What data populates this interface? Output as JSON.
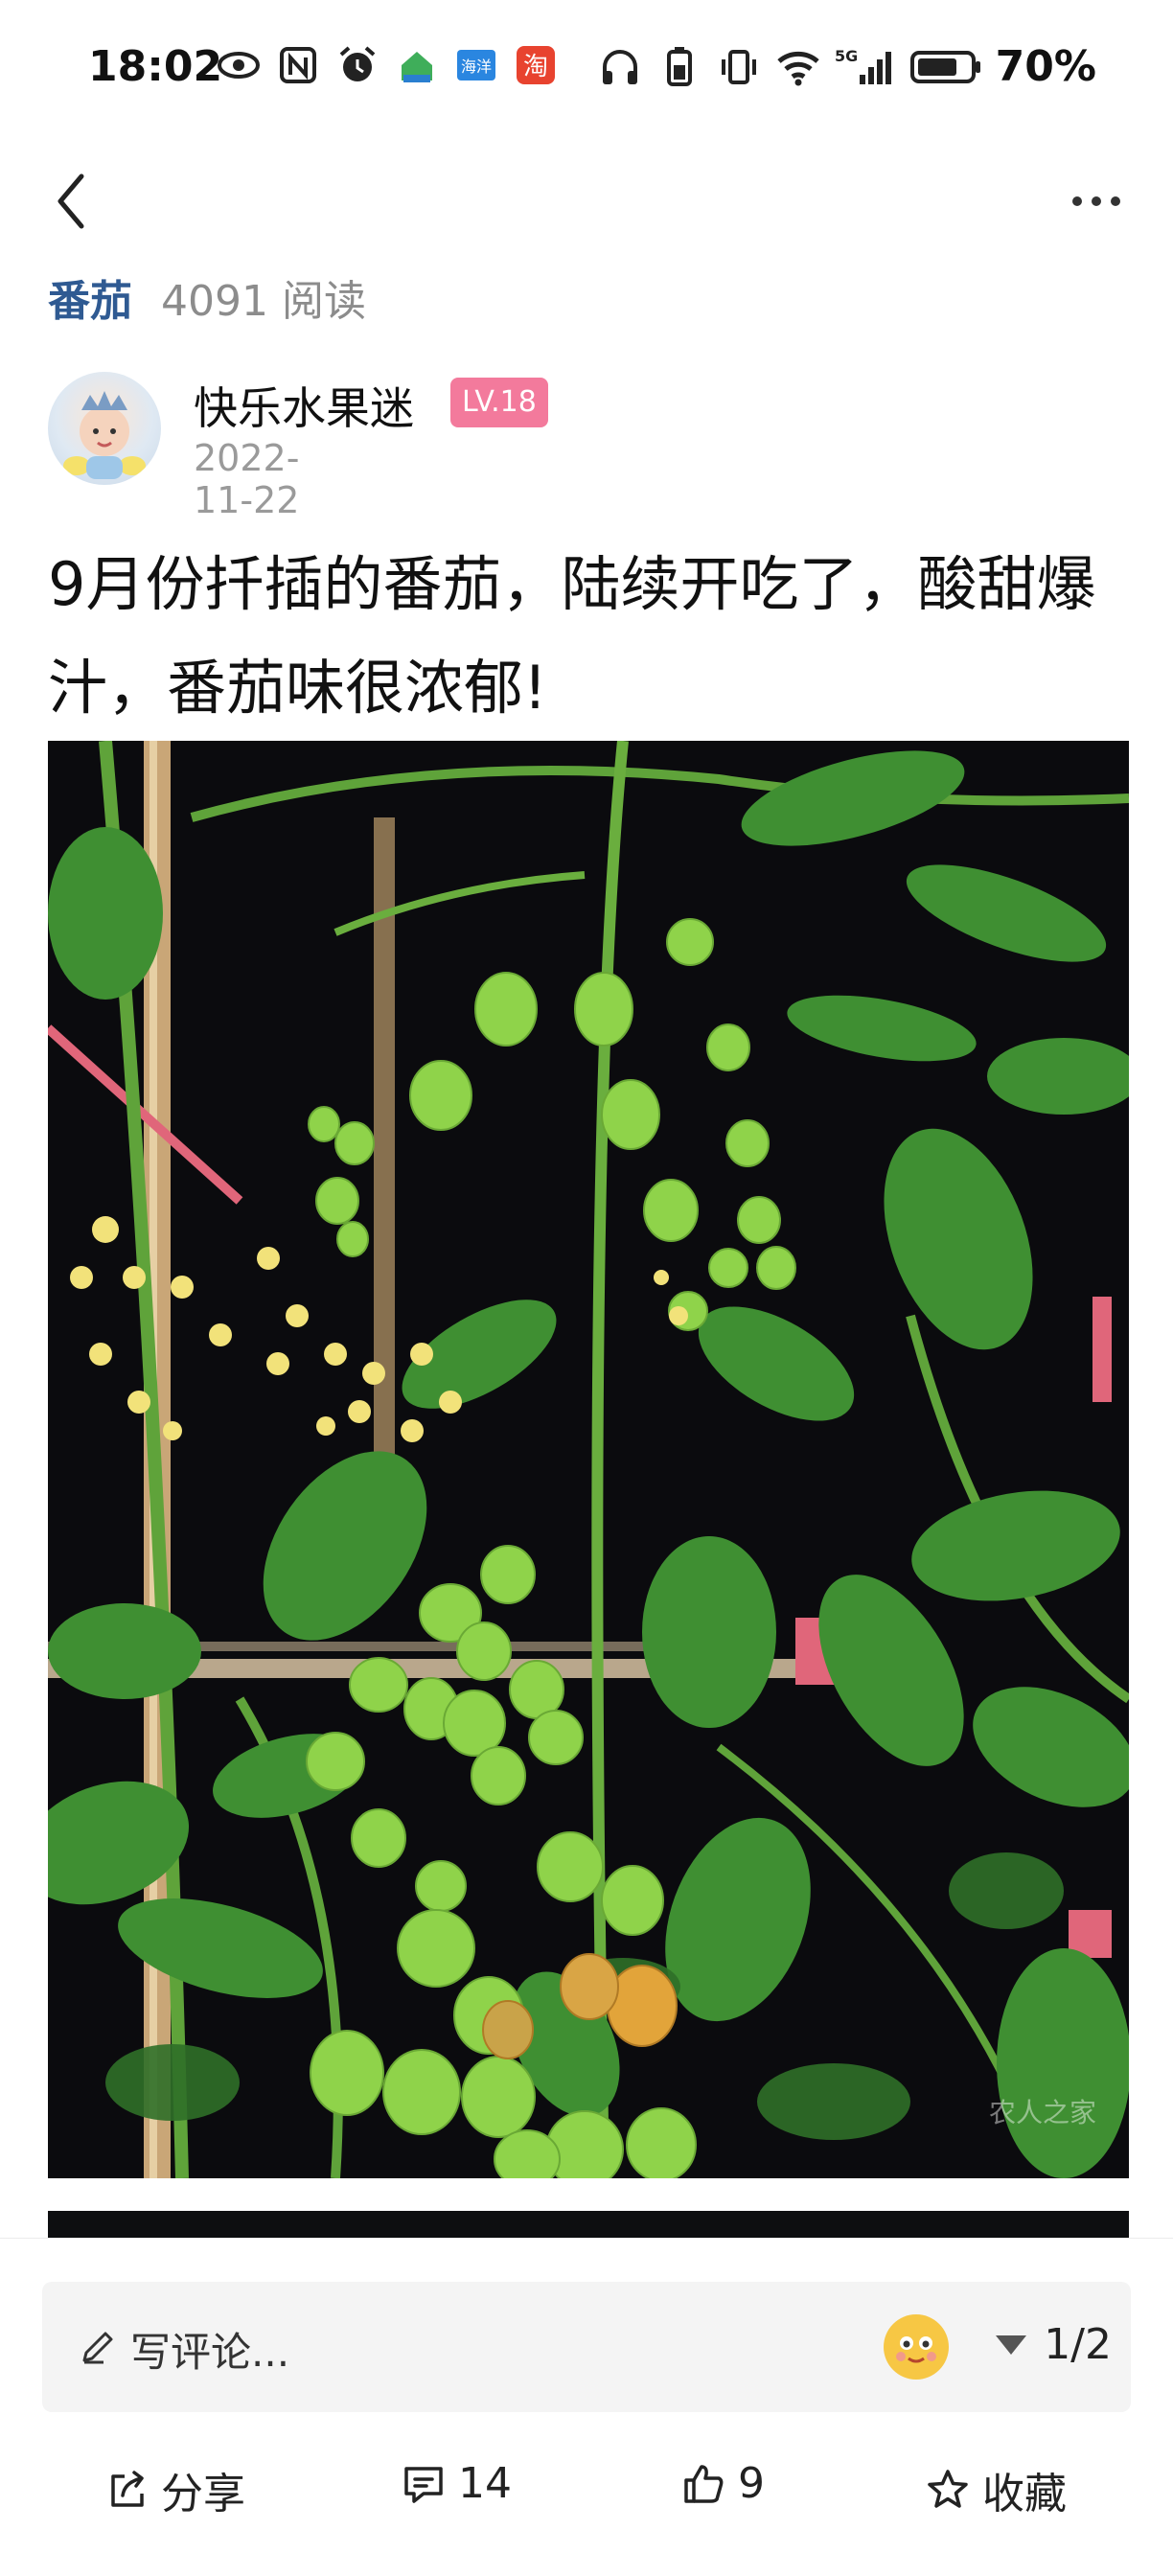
{
  "status_bar": {
    "time": "18:02",
    "left_icons": [
      "eye-icon",
      "nfc-icon",
      "alarm-icon",
      "app-icon-home",
      "app-icon-haiyang",
      "app-icon-taobao"
    ],
    "left_icon_labels": {
      "haiyang": "海洋",
      "taobao": "淘"
    },
    "right_icons": [
      "headphone-icon",
      "battery-saver-icon",
      "vibrate-icon",
      "wifi-icon",
      "5g-signal-icon",
      "battery-icon"
    ],
    "network": "5G",
    "battery": "70%"
  },
  "nav": {
    "back_icon": "chevron-left-icon",
    "more_icon": "more-dots-icon"
  },
  "topic": {
    "name": "番茄",
    "reads": "4091 阅读"
  },
  "author": {
    "name": "快乐水果迷",
    "level": "LV.18",
    "date": "2022-11-22"
  },
  "post": {
    "title": "9月份扦插的番茄，陆续开吃了，酸甜爆汁，番茄味很浓郁!",
    "watermark": "农人之家"
  },
  "comment_bar": {
    "placeholder": "写评论...",
    "emoji_icon": "emoji-face-icon",
    "page_indicator": "1/2"
  },
  "actions": {
    "share_label": "分享",
    "comment_count": "14",
    "like_count": "9",
    "favorite_label": "收藏"
  },
  "colors": {
    "topic_blue": "#2f5a92",
    "level_badge": "#f37a9c",
    "muted_text": "#9a9a9a",
    "photo_background": "#0a0a0d"
  }
}
